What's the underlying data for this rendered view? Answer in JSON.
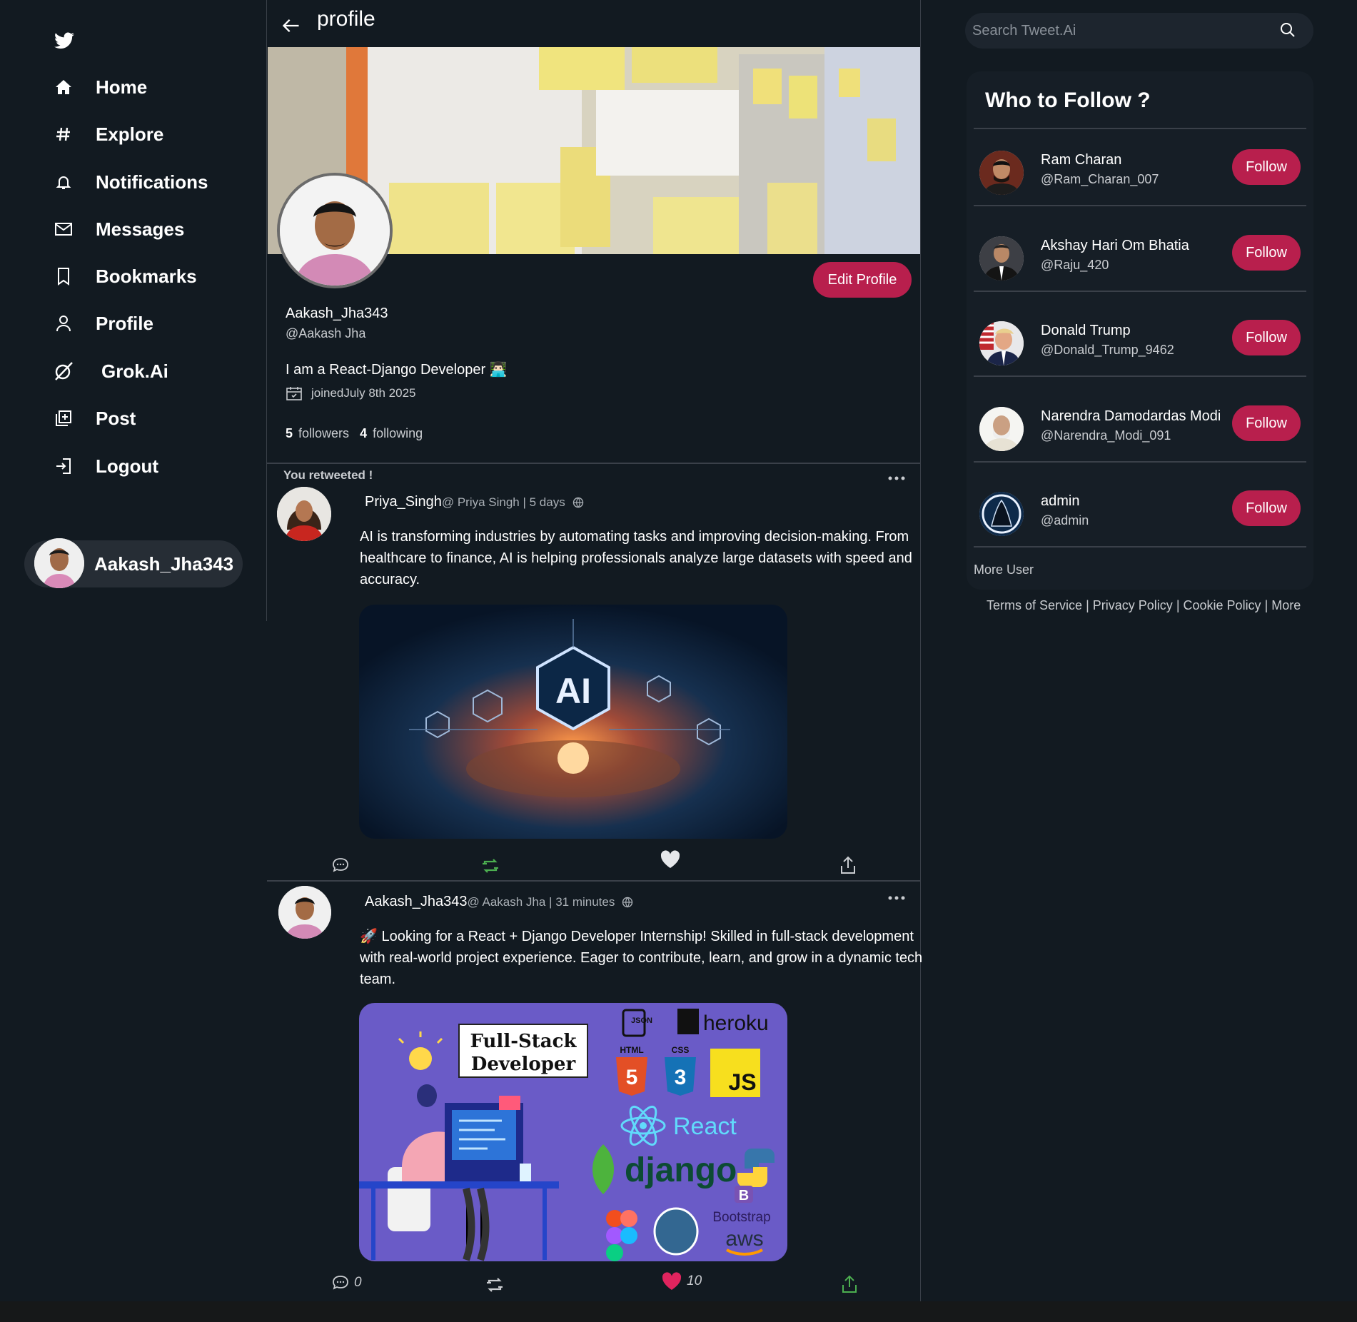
{
  "sidebar": {
    "logo_icon": "twitter-bird-icon",
    "items": [
      {
        "label": "Home",
        "icon": "home-icon"
      },
      {
        "label": "Explore",
        "icon": "hash-icon"
      },
      {
        "label": "Notifications",
        "icon": "bell-icon"
      },
      {
        "label": "Messages",
        "icon": "mail-icon"
      },
      {
        "label": "Bookmarks",
        "icon": "bookmark-icon"
      },
      {
        "label": "Profile",
        "icon": "user-icon"
      },
      {
        "label": "Grok.Ai",
        "icon": "grok-icon"
      },
      {
        "label": "Post",
        "icon": "add-post-icon"
      },
      {
        "label": "Logout",
        "icon": "logout-icon"
      }
    ],
    "user_chip_name": "Aakash_Jha343"
  },
  "header": {
    "title": "profile"
  },
  "profile": {
    "edit_label": "Edit Profile",
    "name": "Aakash_Jha343",
    "handle": "@Aakash Jha",
    "bio": "I am a React-Django Developer 👨🏻‍💻",
    "joined": "joinedJuly 8th 2025",
    "followers_count": "5",
    "followers_label": "followers",
    "following_count": "4",
    "following_label": "following"
  },
  "tweets": [
    {
      "retweet_note": "You retweeted !",
      "username": "Priya_Singh",
      "meta": "@ Priya Singh | 5 days",
      "text": "AI is transforming industries by automating tasks and improving decision-making. From healthcare to finance, AI is helping professionals analyze large datasets with speed and accuracy.",
      "media_text": "AI",
      "reply_count": "",
      "like_count": ""
    },
    {
      "username": "Aakash_Jha343",
      "meta": "@ Aakash Jha | 31 minutes",
      "text": "🚀 Looking for a React + Django Developer Internship! Skilled in full-stack development with real-world project experience. Eager to contribute, learn, and grow in a dynamic tech team.",
      "media": {
        "title_line1": "Full-Stack",
        "title_line2": "Developer",
        "labels": [
          "heroku",
          "HTML",
          "CSS",
          "JS",
          "React",
          "django",
          "Bootstrap",
          "aws",
          "JSON",
          "B"
        ]
      },
      "reply_count": "0",
      "like_count": "10"
    }
  ],
  "search": {
    "placeholder": "Search Tweet.Ai"
  },
  "who_to_follow": {
    "title": "Who to Follow ?",
    "follow_label": "Follow",
    "users": [
      {
        "name": "Ram Charan",
        "handle": "@Ram_Charan_007"
      },
      {
        "name": "Akshay Hari Om Bhatia",
        "handle": "@Raju_420"
      },
      {
        "name": "Donald Trump",
        "handle": "@Donald_Trump_9462"
      },
      {
        "name": "Narendra Damodardas Modi",
        "handle": "@Narendra_Modi_091"
      },
      {
        "name": "admin",
        "handle": "@admin"
      }
    ],
    "more_label": "More User"
  },
  "footer": {
    "terms": "Terms of Service",
    "privacy": "Privacy Policy",
    "cookie": "Cookie Policy",
    "more": "More",
    "sep": "|"
  },
  "colors": {
    "background": "#121a21",
    "accent": "#b81f4d",
    "panel": "#161e26",
    "retweet_green": "#4caf50",
    "like_red": "#e0245e"
  }
}
